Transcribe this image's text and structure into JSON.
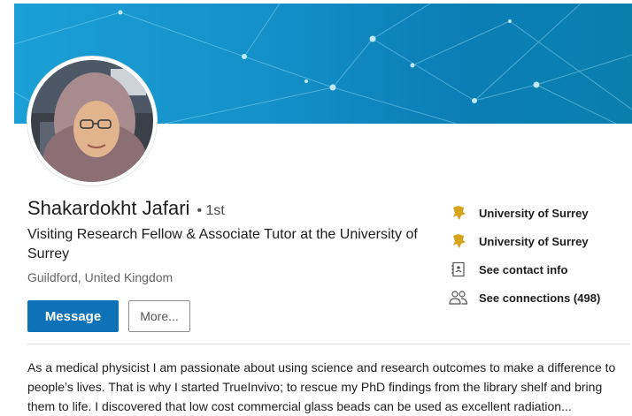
{
  "profile": {
    "name": "Shakardokht Jafari",
    "degree": "• 1st",
    "headline": "Visiting Research Fellow & Associate Tutor at the University of Surrey",
    "location": "Guildford, United Kingdom"
  },
  "actions": {
    "message_label": "Message",
    "more_label": "More..."
  },
  "side": {
    "items": [
      {
        "label": "University of Surrey",
        "icon": "university-crest-icon"
      },
      {
        "label": "University of Surrey",
        "icon": "university-crest-icon"
      },
      {
        "label": "See contact info",
        "icon": "contact-card-icon"
      },
      {
        "label": "See connections (498)",
        "icon": "people-icon"
      }
    ]
  },
  "summary": {
    "text": "As a medical physicist I am passionate about using science and research outcomes to make a difference to people’s lives. That is why I started TrueInvivo; to rescue my PhD findings from the library shelf and bring them to life. I discovered that low cost commercial glass beads can be used as excellent radiation..."
  },
  "colors": {
    "accent": "#0d72b7",
    "banner": "#1590c8",
    "crest": "#d9a21b"
  }
}
